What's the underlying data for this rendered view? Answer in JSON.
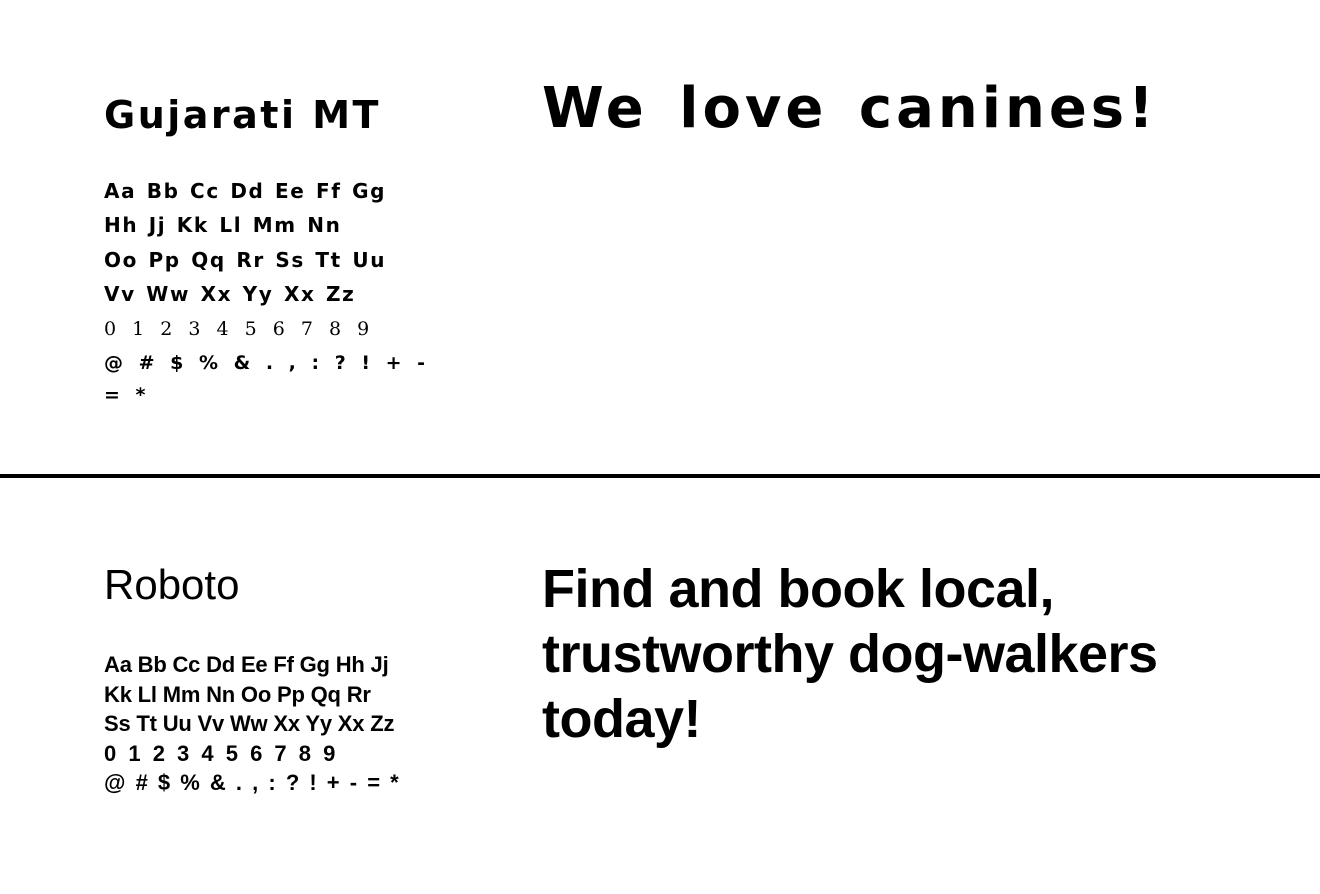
{
  "specimens": [
    {
      "font_name": "Gujarati MT",
      "glyph_rows": [
        "Aa Bb Cc Dd Ee Ff Gg",
        "Hh Jj Kk Ll Mm Nn",
        "Oo Pp Qq Rr Ss Tt Uu",
        "Vv Ww Xx Yy Xx Zz",
        "0 1 2 3 4 5 6 7 8 9",
        "@ # $ % & . , : ? ! + -",
        "= *"
      ],
      "sample_text": "We love canines!"
    },
    {
      "font_name": "Roboto",
      "glyph_rows": [
        "Aa Bb Cc Dd Ee Ff Gg Hh Jj",
        "Kk Ll Mm Nn Oo Pp Qq Rr",
        "Ss Tt Uu Vv Ww Xx Yy Xx Zz",
        "0 1 2 3 4 5 6 7 8 9",
        "@ # $ % & . , : ? ! + - = *"
      ],
      "sample_text": "Find and book local, trustworthy dog-walkers today!"
    }
  ],
  "colors": {
    "background": "#ffffff",
    "text": "#000000",
    "divider": "#000000"
  }
}
